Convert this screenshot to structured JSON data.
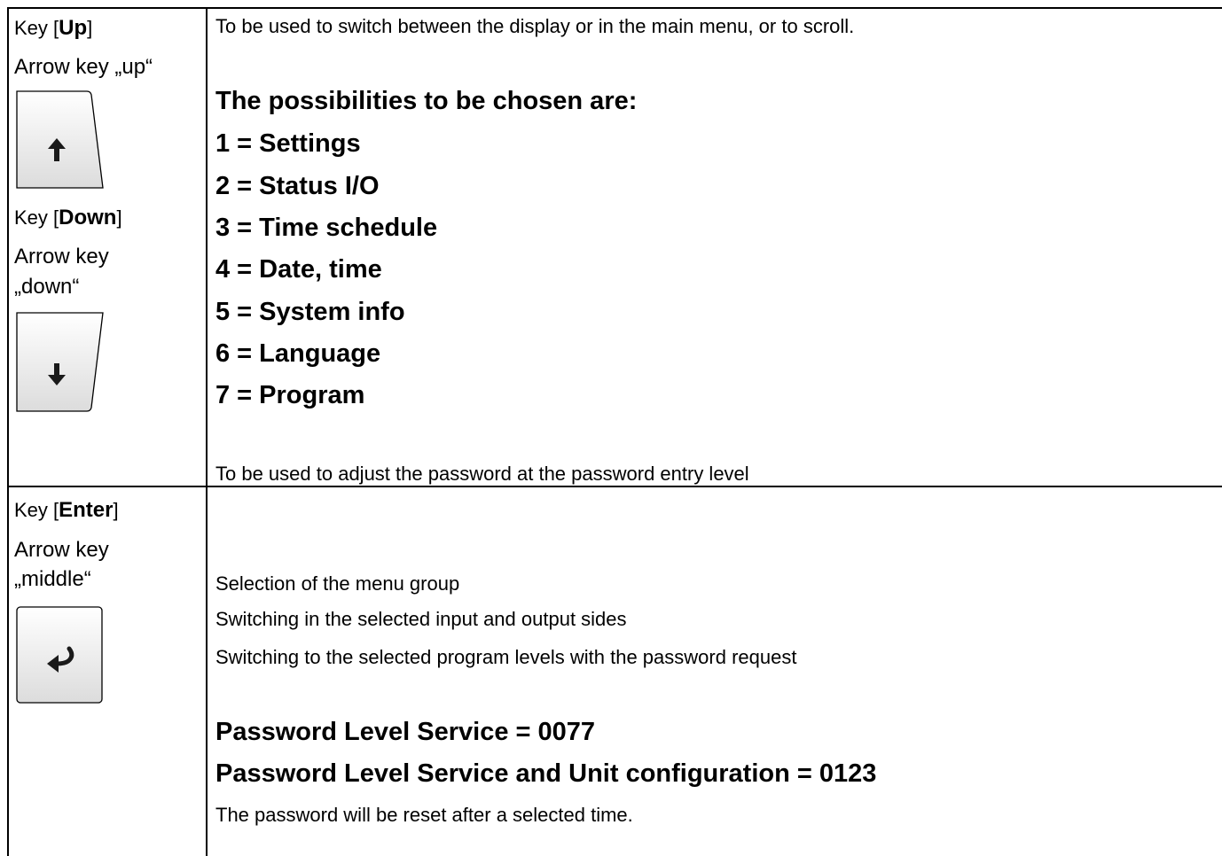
{
  "rows": [
    {
      "keys": [
        {
          "prefix": "Key [",
          "name": "Up",
          "suffix": "]",
          "description": [
            "Arrow key „up“"
          ],
          "icon": "arrow-up-icon"
        },
        {
          "prefix": "Key [",
          "name": "Down",
          "suffix": "]",
          "description": [
            "Arrow key",
            "„down“"
          ],
          "icon": "arrow-down-icon"
        }
      ],
      "intro": "To be used to switch between the display or in the main menu, or to scroll.",
      "heading": "The possibilities to be chosen are:",
      "options": [
        "1 = Settings",
        "2 = Status I/O",
        "3 = Time schedule",
        "4 = Date, time",
        "5 = System info",
        "6 = Language",
        "7 = Program"
      ],
      "footer": "To be used to adjust the password at the password entry level"
    },
    {
      "keys": [
        {
          "prefix": "Key [",
          "name": "Enter",
          "suffix": "]",
          "description": [
            "Arrow key",
            "„middle“"
          ],
          "icon": "enter-icon"
        }
      ],
      "lines": [
        "Selection of the menu group",
        "Switching in the selected input and output sides",
        "Switching to the selected program levels with the password request"
      ],
      "passwords": [
        "Password Level Service = 0077",
        "Password Level Service and Unit configuration = 0123"
      ],
      "note": "The password will be reset after a selected time."
    }
  ],
  "colors": {
    "border": "#000000",
    "key_face_top": "#ffffff",
    "key_face_bottom": "#dcdcdc",
    "icon": "#1a1a1a"
  }
}
